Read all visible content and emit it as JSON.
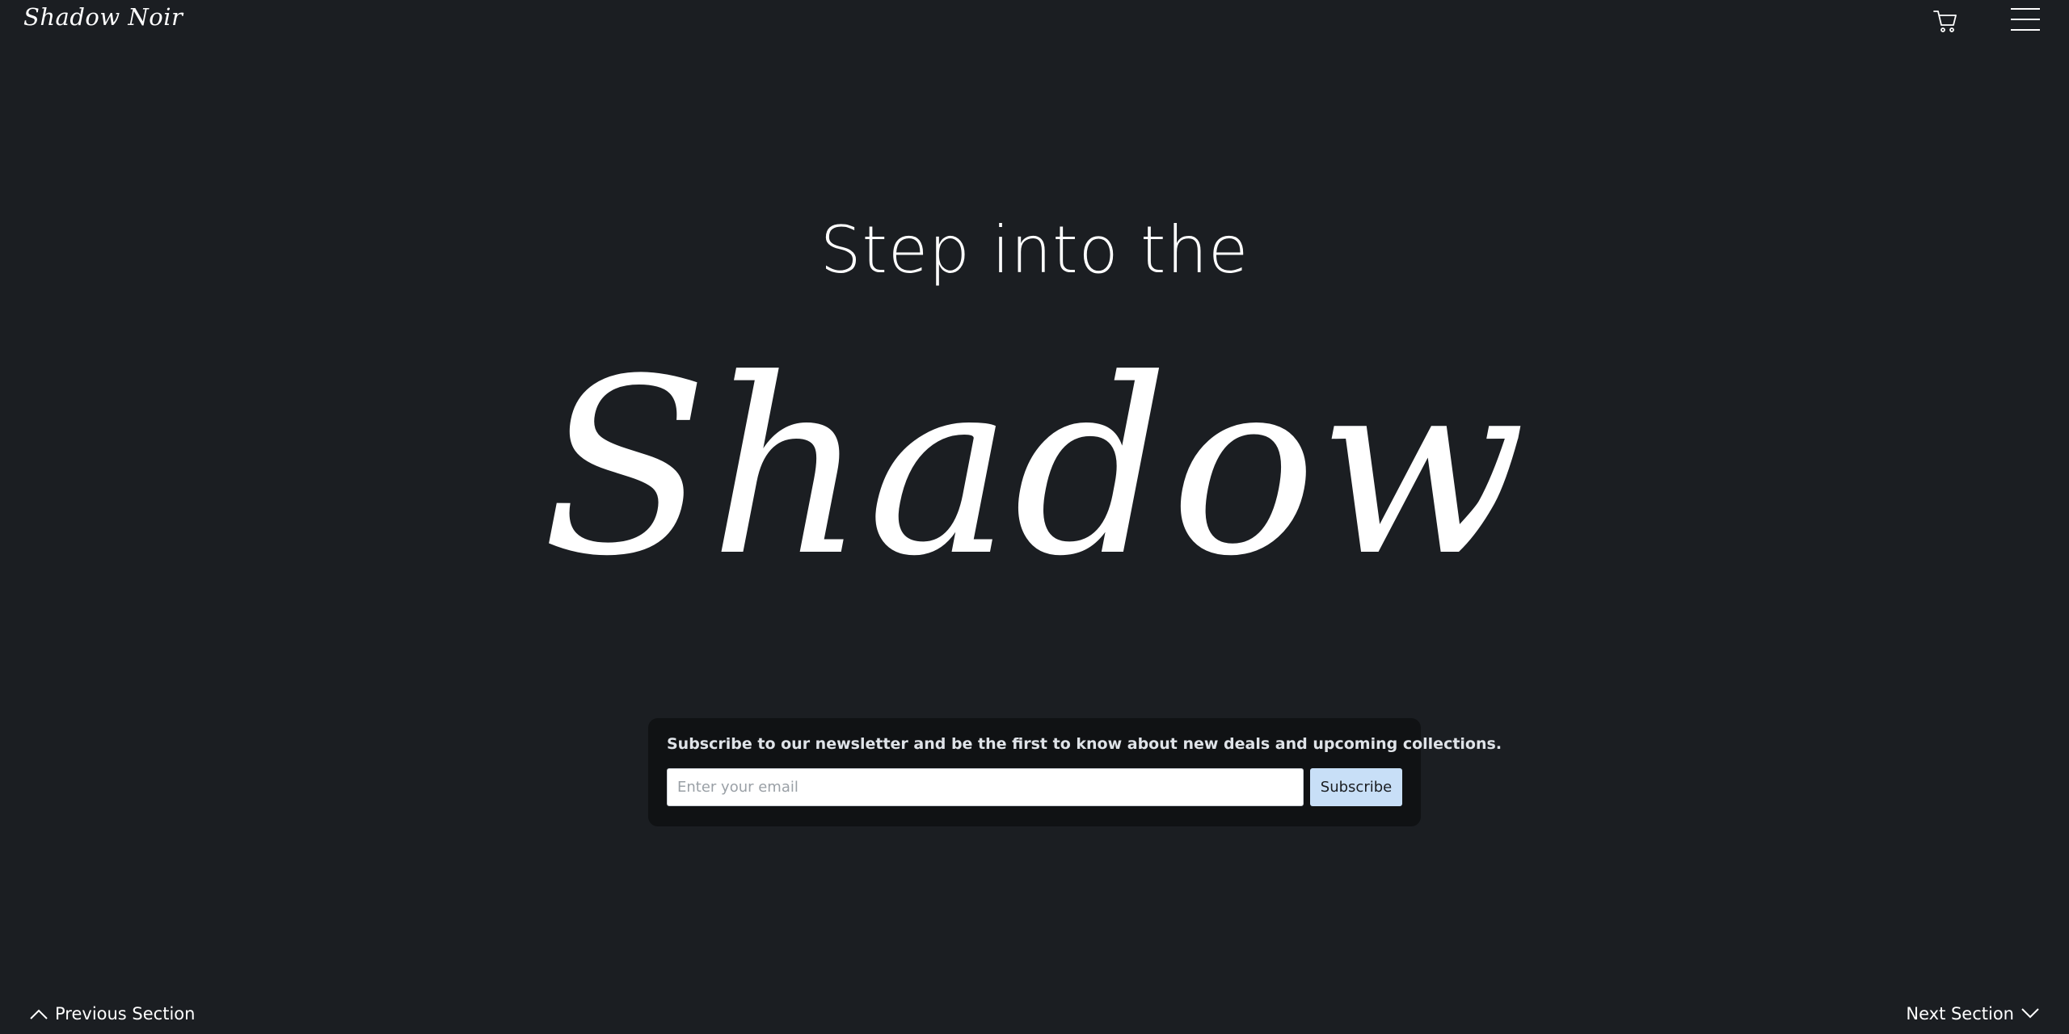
{
  "header": {
    "brand": "Shadow Noir",
    "cart_icon": "cart-icon",
    "menu_icon": "hamburger-menu-icon"
  },
  "hero": {
    "pre_title": "Step into the",
    "title": "Shadow"
  },
  "newsletter": {
    "text": "Subscribe to our newsletter and be the first to know about new deals and upcoming collections.",
    "email_placeholder": "Enter your email",
    "email_value": "",
    "subscribe_label": "Subscribe"
  },
  "nav": {
    "previous_label": "Previous Section",
    "previous_icon": "chevron-up-icon",
    "next_label": "Next Section",
    "next_icon": "chevron-down-icon"
  },
  "colors": {
    "background": "#1b1e22",
    "panel": "#101214",
    "button": "#c8dff7",
    "text": "#ffffff"
  }
}
